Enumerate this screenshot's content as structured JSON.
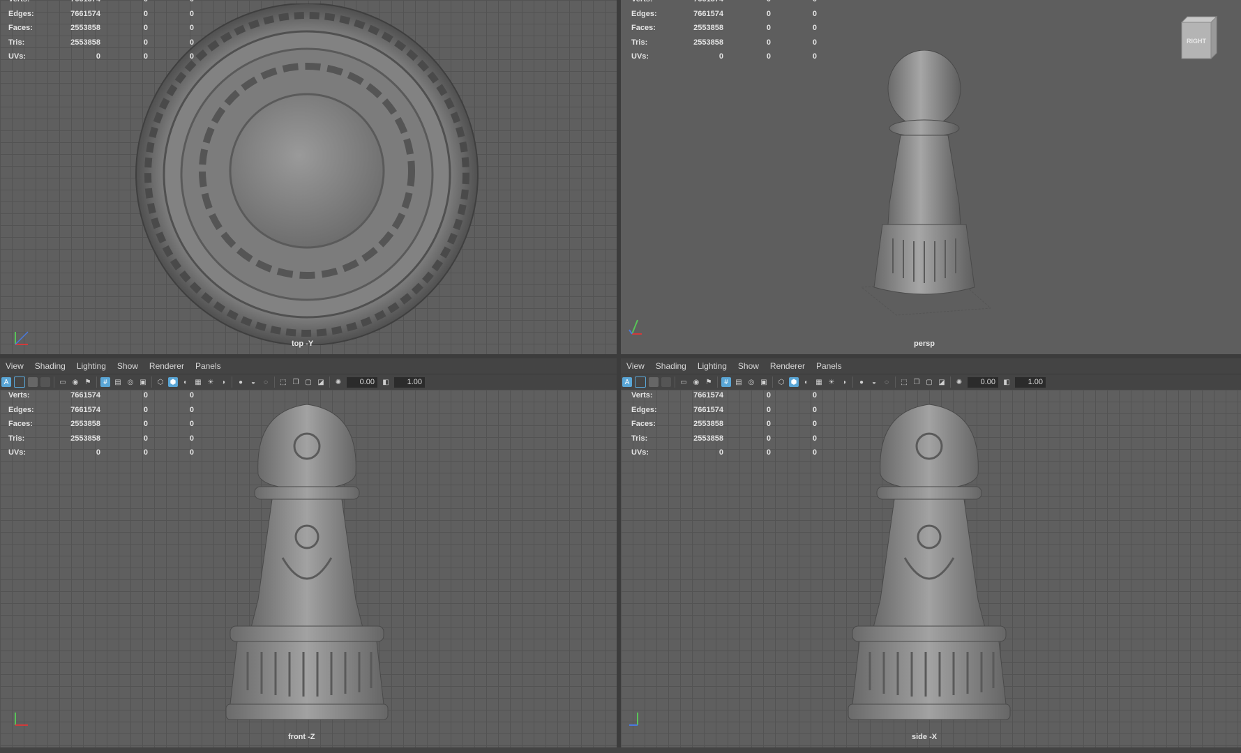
{
  "menus": [
    "View",
    "Shading",
    "Lighting",
    "Show",
    "Renderer",
    "Panels"
  ],
  "hud": {
    "rows": [
      {
        "label": "Verts:",
        "v1": "7661574",
        "v2": "0",
        "v3": "0"
      },
      {
        "label": "Edges:",
        "v1": "7661574",
        "v2": "0",
        "v3": "0"
      },
      {
        "label": "Faces:",
        "v1": "2553858",
        "v2": "0",
        "v3": "0"
      },
      {
        "label": "Tris:",
        "v1": "2553858",
        "v2": "0",
        "v3": "0"
      },
      {
        "label": "UVs:",
        "v1": "0",
        "v2": "0",
        "v3": "0"
      }
    ]
  },
  "toolbar": {
    "field1": "0.00",
    "field2": "1.00",
    "icons": [
      "select-camera-icon",
      "camera-attr-icon",
      "bookmark-icon",
      "image-plane-icon",
      "grid-icon",
      "film-gate-icon",
      "resolution-gate-icon",
      "gate-mask-icon",
      "field-chart-icon",
      "safe-action-icon",
      "safe-title-icon",
      "wireframe-icon",
      "smooth-shade-icon",
      "wireframe-on-shaded-icon",
      "textured-icon",
      "lights-icon",
      "shadows-icon",
      "ambient-occlusion-icon",
      "motion-blur-icon",
      "antialiasing-icon",
      "depth-of-field-icon",
      "isolate-select-icon",
      "xray-icon",
      "xray-joints-icon",
      "backface-icon",
      "exposure-icon",
      "gamma-icon"
    ]
  },
  "viewports": {
    "top": {
      "camera": "top -Y"
    },
    "persp": {
      "camera": "persp",
      "viewcube": "RIGHT"
    },
    "front": {
      "camera": "front -Z"
    },
    "side": {
      "camera": "side -X"
    }
  },
  "colors": {
    "viewport_bg": "#5e5e5e",
    "grid_line": "#535353",
    "panel_bg": "#444444",
    "icon_accent": "#5aa6d6",
    "axis_x": "#d23a3a",
    "axis_y": "#58c458",
    "axis_z": "#4a7ae0"
  }
}
